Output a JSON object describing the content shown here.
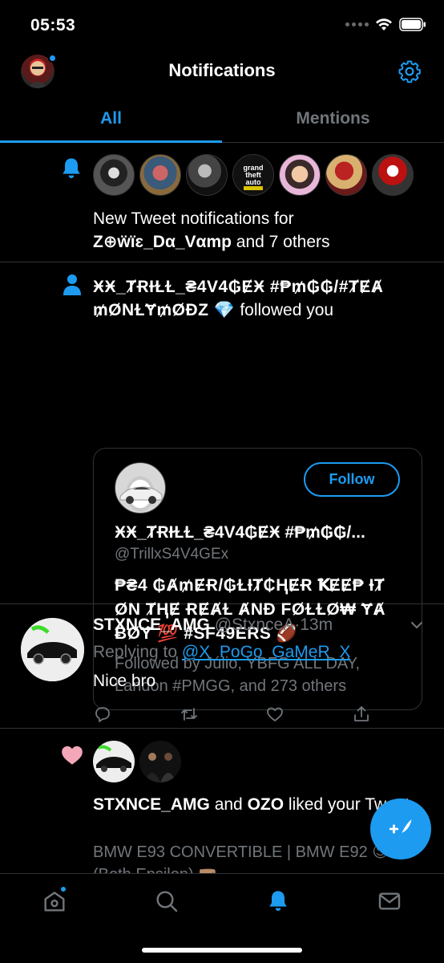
{
  "status_bar": {
    "time": "05:53"
  },
  "header": {
    "title": "Notifications"
  },
  "tabs": [
    {
      "label": "All",
      "active": true
    },
    {
      "label": "Mentions",
      "active": false
    }
  ],
  "new_tweets": {
    "text_prefix": "New Tweet notifications for ",
    "name": "Z⊕ẅїɛ_Dα_Vαmp",
    "text_suffix": " and 7 others",
    "avatar_count": 7
  },
  "follow": {
    "follower_name": "ӾӾ_ȾɌƗⱢⱢ_₴4V4₲ɆӾ #₱₥₲₲/#ȾɆȺ ₥ØNⱢɎ₥ØĐZ 💎",
    "action": " followed you",
    "card": {
      "follow_button": "Follow",
      "display_name": "ӾӾ_ȾɌƗⱢⱢ_₴4V4₲ɆӾ #₱₥₲₲/...",
      "handle": "@TrillxS4V4GEx",
      "bio": "₱₴4 ₲Ⱥ₥ɆɌ/₲ⱢƗȾ₵ⱧɆɌ ꝀɆɆ₱ ƗȾ ØN ȾⱧɆ ɌɆȺⱢ ȺNĐ FØⱢⱢØ₩ ɎȺ ɃØɎ 💯 #SF49ERS 🏈",
      "followed_by": "Followed by Júlio, YBFG ALL DAY, Landon #PMGG, and 273 others"
    }
  },
  "tweet": {
    "name": "STXNCE_AMG",
    "handle": "@StxnceA",
    "separator": "·",
    "time": "13m",
    "replying_label": "Replying to ",
    "replying_to": "@X_PoGo_GaMeR_X",
    "body": "Nice bro"
  },
  "like": {
    "name1": "STXNCE_AMG",
    "and": " and ",
    "name2": "OZO",
    "action": " liked your Tweet",
    "snippet": "BMW E93 CONVERTIBLE  |  BMW E92 😍😍 (Both Epsilon) 🤜🏽"
  },
  "icons": {
    "bell": "bell-icon",
    "person": "person-icon",
    "heart": "heart-icon",
    "gear": "gear-icon",
    "compose": "compose-feather-icon"
  },
  "colors": {
    "accent": "#1d9bf0",
    "background": "#000000",
    "secondary_text": "#71767b",
    "divider": "#2f3336",
    "like": "#f4a7b9"
  }
}
